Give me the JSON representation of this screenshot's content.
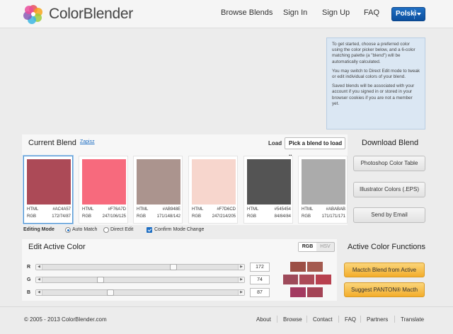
{
  "header": {
    "brand": "ColorBlender",
    "nav": [
      "Browse Blends",
      "Sign In",
      "Sign Up",
      "FAQ"
    ],
    "language": "Polski",
    "logo_colors": [
      "#e8505b",
      "#f7a51c",
      "#9ccc3d",
      "#3cb6e3",
      "#8a5bb5",
      "#e94d9c"
    ]
  },
  "info": {
    "paragraphs": [
      "To get started, choose a preferred color using the color picker below, and a 6-color matching palette (a \"blend\") will be automatically calculated.",
      "You may switch to Direct Edit mode to tweak or edit individual colors of your blend.",
      "Saved blends will be associated with your account if you signed in or stored in your browser cookies if you are not a member yet."
    ]
  },
  "current_blend": {
    "title": "Current Blend",
    "save_link": "Zapisz",
    "load_label": "Load",
    "load_select": "Pick a blend to load ..",
    "swatches": [
      {
        "html_label": "HTML",
        "html": "#AC4A57",
        "rgb_label": "RGB",
        "rgb": "172/74/87",
        "color": "#ac4a57"
      },
      {
        "html_label": "HTML",
        "html": "#F76A7D",
        "rgb_label": "RGB",
        "rgb": "247/106/125",
        "color": "#f76a7d"
      },
      {
        "html_label": "HTML",
        "html": "#AB948E",
        "rgb_label": "RGB",
        "rgb": "171/148/142",
        "color": "#ab948e"
      },
      {
        "html_label": "HTML",
        "html": "#F7D6CD",
        "rgb_label": "RGB",
        "rgb": "247/214/205",
        "color": "#f7d6cd"
      },
      {
        "html_label": "HTML",
        "html": "#545454",
        "rgb_label": "RGB",
        "rgb": "84/84/84",
        "color": "#545454"
      },
      {
        "html_label": "HTML",
        "html": "#ABABAB",
        "rgb_label": "RGB",
        "rgb": "171/171/171",
        "color": "#ababab"
      }
    ],
    "editing_mode_label": "Editing Mode",
    "auto_match": "Auto Match",
    "direct_edit": "Direct Edit",
    "confirm_mode": "Confirm Mode Change"
  },
  "download": {
    "title": "Download Blend",
    "photoshop": "Photoshop Color Table",
    "illustrator": "Illustrator Colors (.EPS)",
    "email": "Send by Email"
  },
  "edit": {
    "title": "Edit Active Color",
    "tab_rgb": "RGB",
    "tab_hsv": "HSV",
    "r_label": "R",
    "g_label": "G",
    "b_label": "B",
    "r_value": "172",
    "g_value": "74",
    "b_value": "87",
    "r_level": 0.675,
    "g_level": 0.29,
    "b_level": 0.341
  },
  "functions": {
    "title": "Active Color Functions",
    "match_button": "Mactch Blend from Active",
    "pantone_button": "Suggest PANTON® Macth"
  },
  "footer": {
    "copyright": "© 2005 - 2013 ColorBlender.com",
    "links": [
      "About",
      "Browse",
      "Contact",
      "FAQ",
      "Partners",
      "Translate"
    ]
  }
}
